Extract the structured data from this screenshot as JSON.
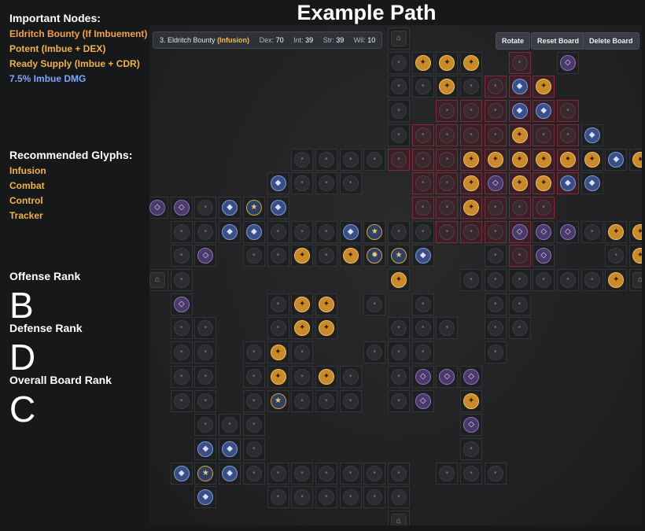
{
  "page": {
    "title": "Example Path"
  },
  "sidebar": {
    "important_heading": "Important Nodes:",
    "important_nodes": [
      {
        "label": "Eldritch Bounty (If Imbuement)",
        "color": "#f0a34a"
      },
      {
        "label": "Potent (Imbue + DEX)",
        "color": "#f0b24a"
      },
      {
        "label": "Ready Supply (Imbue + CDR)",
        "color": "#f0b24a"
      },
      {
        "label": "7.5% Imbue DMG",
        "color": "#7ea6ff"
      }
    ],
    "glyphs_heading": "Recommended Glyphs:",
    "glyphs": [
      "Infusion",
      "Combat",
      "Control",
      "Tracker"
    ],
    "offense_label": "Offense Rank",
    "offense_rank": "B",
    "defense_label": "Defense Rank",
    "defense_rank": "D",
    "overall_label": "Overall Board Rank",
    "overall_rank": "C"
  },
  "board": {
    "info_name": "3. Eldritch Bounty",
    "info_glyph": "(Infusion)",
    "stats": [
      {
        "k": "Dex:",
        "v": "70"
      },
      {
        "k": "Int:",
        "v": "39"
      },
      {
        "k": "Str:",
        "v": "39"
      },
      {
        "k": "Wil:",
        "v": "10"
      }
    ],
    "buttons": {
      "rotate": "Rotate",
      "reset": "Reset Board",
      "delete": "Delete Board"
    },
    "grid_rows": [
      "..........G..........",
      "..........NOOO...P...",
      "..........NNONNBO....",
      "..........N...NBB....",
      "..........N..NNO..B..",
      "......NNNNN.NOOOOOOBL",
      ".....BNNN....OPOOBB..",
      "PPNBYB.......O.......",
      ".NNBBNNNBYNN.NNPPPNOO",
      ".NP.NNONOWYB..NNP..NO",
      "GN........O..NNNNNNOG",
      ".P...NOO.N.N..NN.....",
      ".NN..NOO..NNN.NN.....",
      ".NN.NON..NNN..N......",
      ".NN.NONON.NPPP.......",
      ".NN.NYNNN.NP.O.......",
      "..NNN........P.......",
      "..BBN........N.......",
      ".BYBNNNNNNN.NNN......",
      "..B..NNNNNN..........",
      "..........G.........."
    ],
    "highlight_rows": [
      ".....................",
      "...............#.....",
      "..............###....",
      "............######...",
      "...........#######...",
      "..........########...",
      "...........#######...",
      "...........######....",
      "............####.....",
      "...............#.....",
      ".....................",
      ".....................",
      ".....................",
      ".....................",
      ".....................",
      ".....................",
      ".....................",
      ".....................",
      ".....................",
      ".....................",
      "....................."
    ]
  }
}
